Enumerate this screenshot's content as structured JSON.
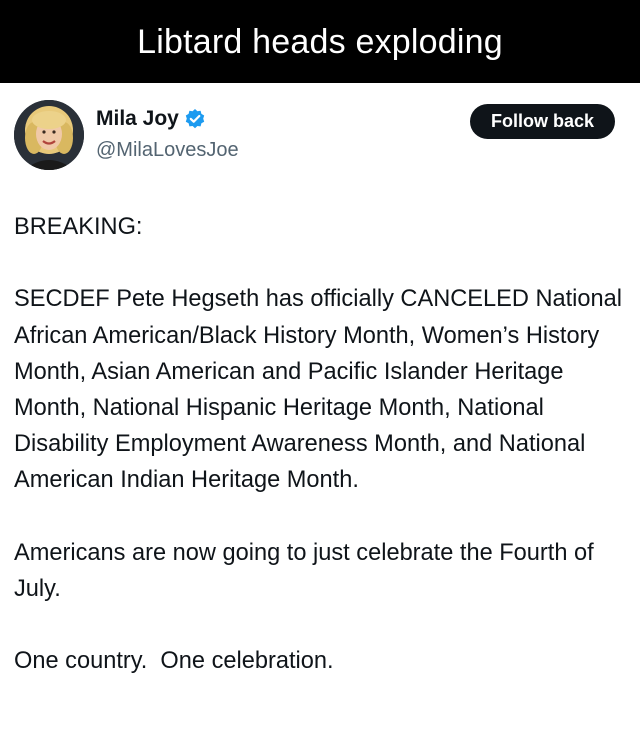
{
  "caption": {
    "text": "Libtard heads exploding"
  },
  "post": {
    "author": {
      "display_name": "Mila Joy",
      "handle": "@MilaLovesJoe",
      "verified": true,
      "avatar_icon": "profile-photo"
    },
    "follow_button_label": "Follow back",
    "paragraphs": [
      "BREAKING:",
      "SECDEF Pete Hegseth has officially CANCELED National African American/Black History Month, Women’s History Month, Asian American and Pacific Islander Heritage Month, National Hispanic Heritage Month, National Disability Employment Awareness Month, and National American Indian Heritage Month.",
      "Americans are now going to just celebrate the Fourth of July.",
      "One country.  One celebration."
    ]
  },
  "colors": {
    "caption_bg": "#000000",
    "text_primary": "#0f1419",
    "text_secondary": "#536471",
    "verified_blue": "#1d9bf0",
    "button_bg": "#0f1419"
  }
}
